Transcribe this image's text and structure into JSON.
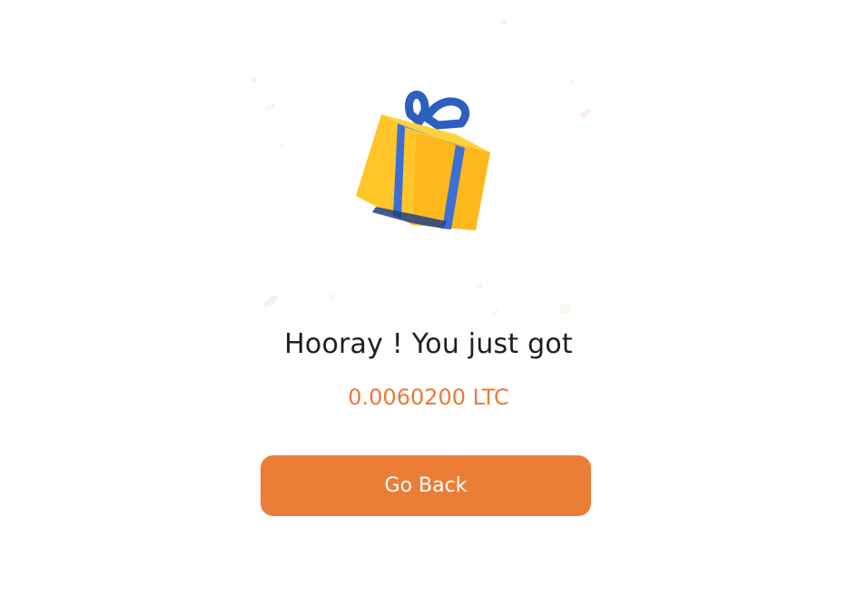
{
  "reward": {
    "headline": "Hooray ! You just got",
    "amount": "0.0060200 LTC",
    "go_back_label": "Go Back"
  },
  "icons": {
    "gift": "gift-box-icon",
    "confetti": "confetti-decoration"
  },
  "colors": {
    "accent": "#EC7D36",
    "amount_text": "#EC7A36",
    "headline_text": "#1E1E24",
    "gift_box": "#FFC72C",
    "gift_ribbon": "#3B6FD6"
  }
}
